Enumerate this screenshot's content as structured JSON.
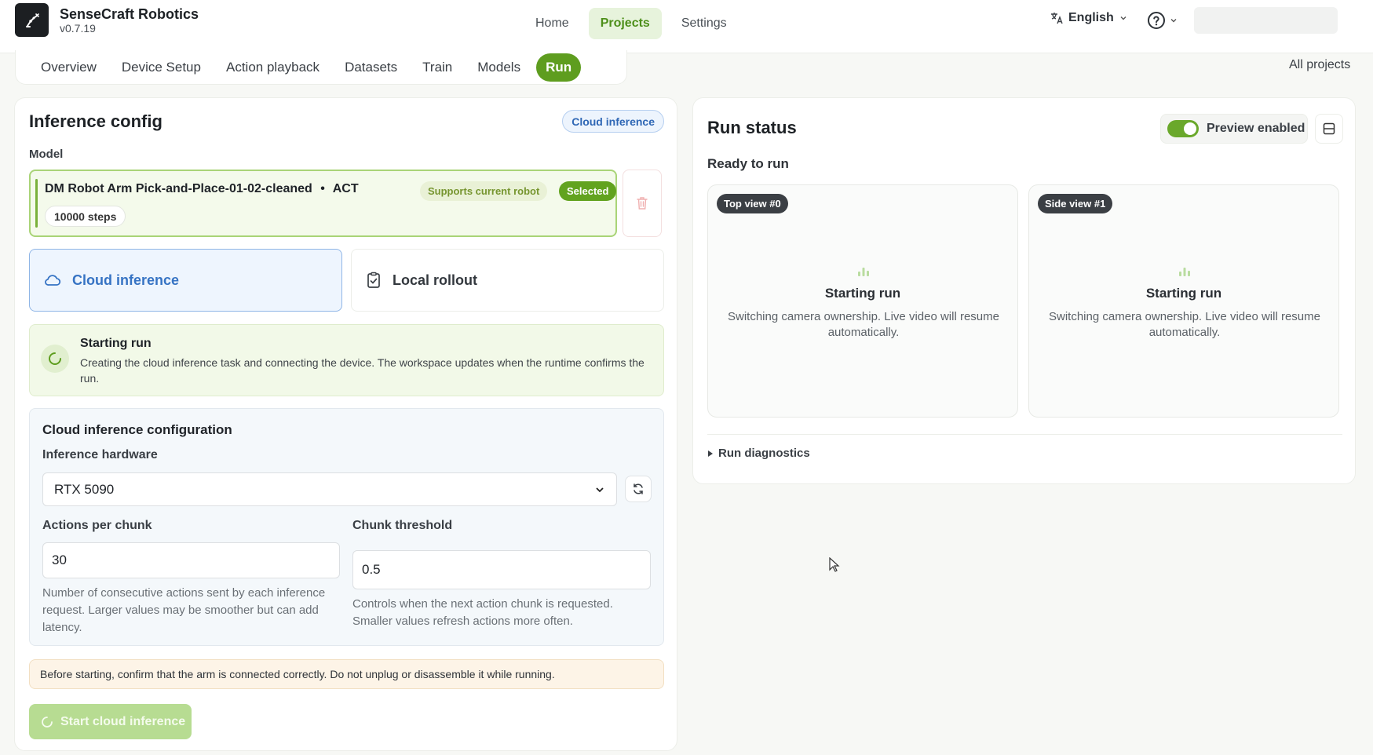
{
  "app": {
    "name": "SenseCraft Robotics",
    "version": "v0.7.19"
  },
  "topnav": {
    "items": [
      {
        "label": "Home"
      },
      {
        "label": "Projects"
      },
      {
        "label": "Settings"
      }
    ],
    "active": "Projects",
    "language": "English"
  },
  "subtabs": {
    "items": [
      {
        "label": "Overview"
      },
      {
        "label": "Device Setup"
      },
      {
        "label": "Action playback"
      },
      {
        "label": "Datasets"
      },
      {
        "label": "Train"
      },
      {
        "label": "Models"
      },
      {
        "label": "Run"
      }
    ],
    "active": "Run",
    "all_projects": "All projects"
  },
  "inference": {
    "title": "Inference config",
    "badge": "Cloud inference",
    "model_label": "Model",
    "model": {
      "name": "DM Robot Arm Pick-and-Place-01-02-cleaned",
      "separator": "•",
      "algo": "ACT",
      "steps": "10000 steps",
      "supports": "Supports current robot",
      "selected": "Selected"
    },
    "modes": {
      "cloud": "Cloud inference",
      "local": "Local rollout"
    },
    "status": {
      "title": "Starting run",
      "desc": "Creating the cloud inference task and connecting the device. The workspace updates when the runtime confirms the run."
    },
    "config": {
      "title": "Cloud inference configuration",
      "hardware_label": "Inference hardware",
      "hardware_value": "RTX 5090",
      "apc_label": "Actions per chunk",
      "apc_value": "30",
      "apc_help": "Number of consecutive actions sent by each inference request. Larger values may be smoother but can add latency.",
      "ct_label": "Chunk threshold",
      "ct_value": "0.5",
      "ct_help": "Controls when the next action chunk is requested. Smaller values refresh actions more often."
    },
    "warning": "Before starting, confirm that the arm is connected correctly. Do not unplug or disassemble it while running.",
    "start_button": "Start cloud inference"
  },
  "run_status": {
    "title": "Run status",
    "ready": "Ready to run",
    "preview": "Preview enabled",
    "preview_on": true,
    "cameras": [
      {
        "tag": "Top view #0",
        "title": "Starting run",
        "desc": "Switching camera ownership. Live video will resume automatically."
      },
      {
        "tag": "Side view #1",
        "title": "Starting run",
        "desc": "Switching camera ownership. Live video will resume automatically."
      }
    ],
    "diagnostics": "Run diagnostics"
  },
  "colors": {
    "accent_green": "#5e9d1f",
    "cloud_blue": "#3673c4",
    "warning_bg": "#fdf4e7"
  }
}
